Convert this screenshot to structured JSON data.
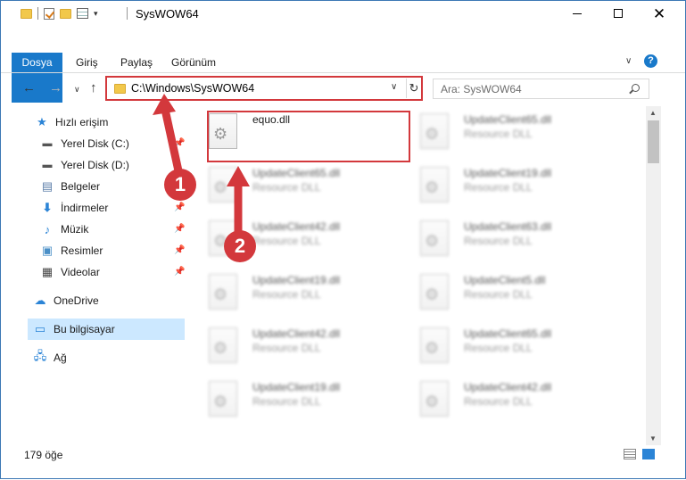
{
  "window": {
    "title": "SysWOW64",
    "minimize": "—",
    "maximize": "☐",
    "close": "✕"
  },
  "ribbon": {
    "tabs": [
      "Dosya",
      "Giriş",
      "Paylaş",
      "Görünüm"
    ],
    "help": "?"
  },
  "address": {
    "path": "C:\\Windows\\SysWOW64"
  },
  "search": {
    "placeholder": "Ara: SysWOW64"
  },
  "sidebar": {
    "items": [
      {
        "label": "Hızlı erişim",
        "icon": "star-icon"
      },
      {
        "label": "Yerel Disk (C:)",
        "icon": "drive-icon"
      },
      {
        "label": "Yerel Disk (D:)",
        "icon": "drive-icon"
      },
      {
        "label": "Belgeler",
        "icon": "documents-icon"
      },
      {
        "label": "İndirmeler",
        "icon": "download-icon"
      },
      {
        "label": "Müzik",
        "icon": "music-icon"
      },
      {
        "label": "Resimler",
        "icon": "pictures-icon"
      },
      {
        "label": "Videolar",
        "icon": "video-icon"
      },
      {
        "label": "OneDrive",
        "icon": "cloud-icon"
      },
      {
        "label": "Bu bilgisayar",
        "icon": "computer-icon"
      },
      {
        "label": "Ağ",
        "icon": "network-icon"
      }
    ]
  },
  "files": [
    {
      "name": "equo.dll",
      "type": ""
    },
    {
      "name": "UpdateClient65.dll",
      "type": "Resource DLL"
    },
    {
      "name": "UpdateClient65.dll",
      "type": "Resource DLL"
    },
    {
      "name": "UpdateClient19.dll",
      "type": "Resource DLL"
    },
    {
      "name": "UpdateClient42.dll",
      "type": "Resource DLL"
    },
    {
      "name": "UpdateClient63.dll",
      "type": "Resource DLL"
    },
    {
      "name": "UpdateClient19.dll",
      "type": "Resource DLL"
    },
    {
      "name": "UpdateClient5.dll",
      "type": "Resource DLL"
    },
    {
      "name": "UpdateClient42.dll",
      "type": "Resource DLL"
    },
    {
      "name": "UpdateClient65.dll",
      "type": "Resource DLL"
    },
    {
      "name": "UpdateClient19.dll",
      "type": "Resource DLL"
    },
    {
      "name": "UpdateClient42.dll",
      "type": "Resource DLL"
    }
  ],
  "status": {
    "item_count": "179 öğe"
  },
  "annotations": {
    "step1": "1",
    "step2": "2",
    "color": "#d3383c"
  }
}
